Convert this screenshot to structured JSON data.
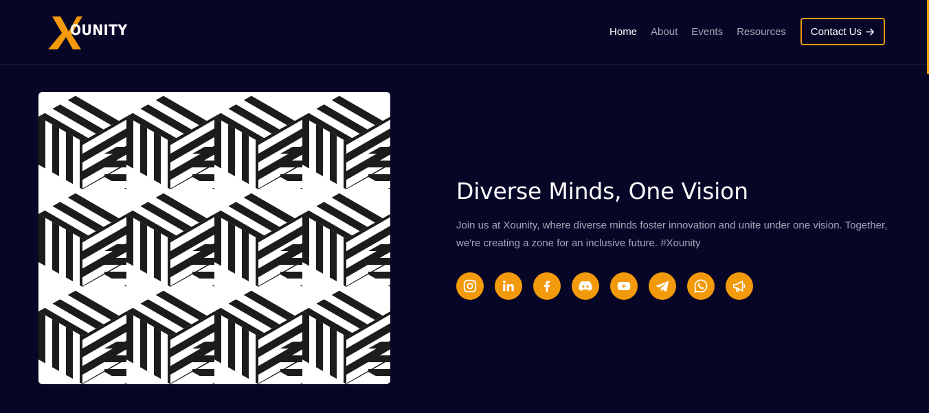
{
  "brand": {
    "name": "XOUNITY",
    "letter": "X",
    "rest": "OUNITY",
    "accent": "#f29a0b",
    "background": "#080627"
  },
  "nav": {
    "items": [
      {
        "label": "Home",
        "active": true
      },
      {
        "label": "About",
        "active": false
      },
      {
        "label": "Events",
        "active": false
      },
      {
        "label": "Resources",
        "active": false
      }
    ],
    "contact_label": "Contact Us"
  },
  "hero": {
    "image_icon": "geometric-pattern-image",
    "title": "Diverse Minds, One Vision",
    "description": "Join us at Xounity, where diverse minds foster innovation and unite under one vision. Together, we're creating a zone for an inclusive future. #Xounity"
  },
  "socials": [
    {
      "name": "instagram-icon"
    },
    {
      "name": "linkedin-icon"
    },
    {
      "name": "facebook-icon"
    },
    {
      "name": "discord-icon"
    },
    {
      "name": "youtube-icon"
    },
    {
      "name": "telegram-icon"
    },
    {
      "name": "whatsapp-icon"
    },
    {
      "name": "megaphone-icon"
    }
  ]
}
